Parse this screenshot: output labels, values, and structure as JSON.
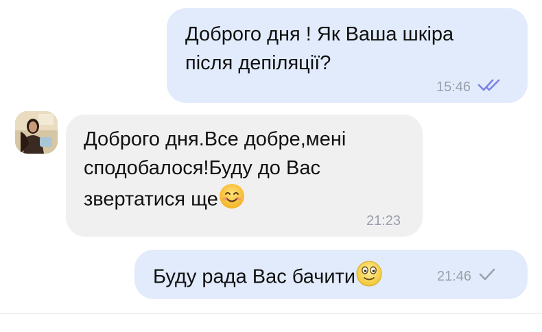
{
  "messages": [
    {
      "direction": "outgoing",
      "text": "Доброго дня ! Як Ваша шкіра\nпісля депіляції?",
      "time": "15:46",
      "status": "read"
    },
    {
      "direction": "incoming",
      "text": "Доброго дня.Все добре,мені\nсподобалося!Буду до Вас\nзвертатися ще",
      "emoji": "smiling-face-with-smiling-eyes",
      "time": "21:23"
    },
    {
      "direction": "outgoing",
      "text": "Буду рада Вас бачити",
      "emoji": "smiling-face-with-open-eyes",
      "time": "21:46",
      "status": "sent"
    }
  ],
  "colors": {
    "outgoing_bubble": "#e1ebfb",
    "incoming_bubble": "#f0f0f1",
    "timestamp": "#9aa0aa",
    "read_check": "#7b82e6"
  }
}
